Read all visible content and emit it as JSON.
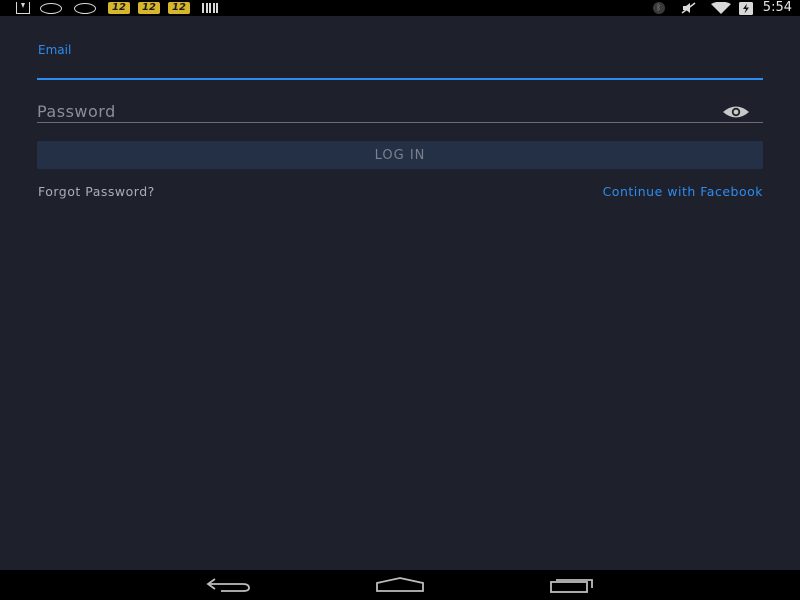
{
  "status_bar": {
    "time": "5:54",
    "left_icons": [
      "download-icon",
      "notification-oval-icon",
      "notification-oval-icon",
      "badge-12-icon",
      "badge-12-icon",
      "badge-12-icon",
      "barcode-icon"
    ],
    "badge_text": "12",
    "right_icons": [
      "bluetooth-icon",
      "mute-icon",
      "wifi-icon",
      "battery-charging-icon"
    ]
  },
  "login": {
    "email_label": "Email",
    "email_value": "",
    "password_placeholder": "Password",
    "password_value": "",
    "login_button": "LOG IN",
    "forgot_password": "Forgot Password?",
    "facebook": "Continue with Facebook"
  },
  "nav_bar": {
    "buttons": [
      "back-icon",
      "home-icon",
      "recents-icon"
    ]
  },
  "colors": {
    "background": "#1e212b",
    "accent": "#2d8cf0",
    "button_bg": "#233046",
    "button_text": "#7b818c",
    "secondary_text": "#a9adb5"
  }
}
